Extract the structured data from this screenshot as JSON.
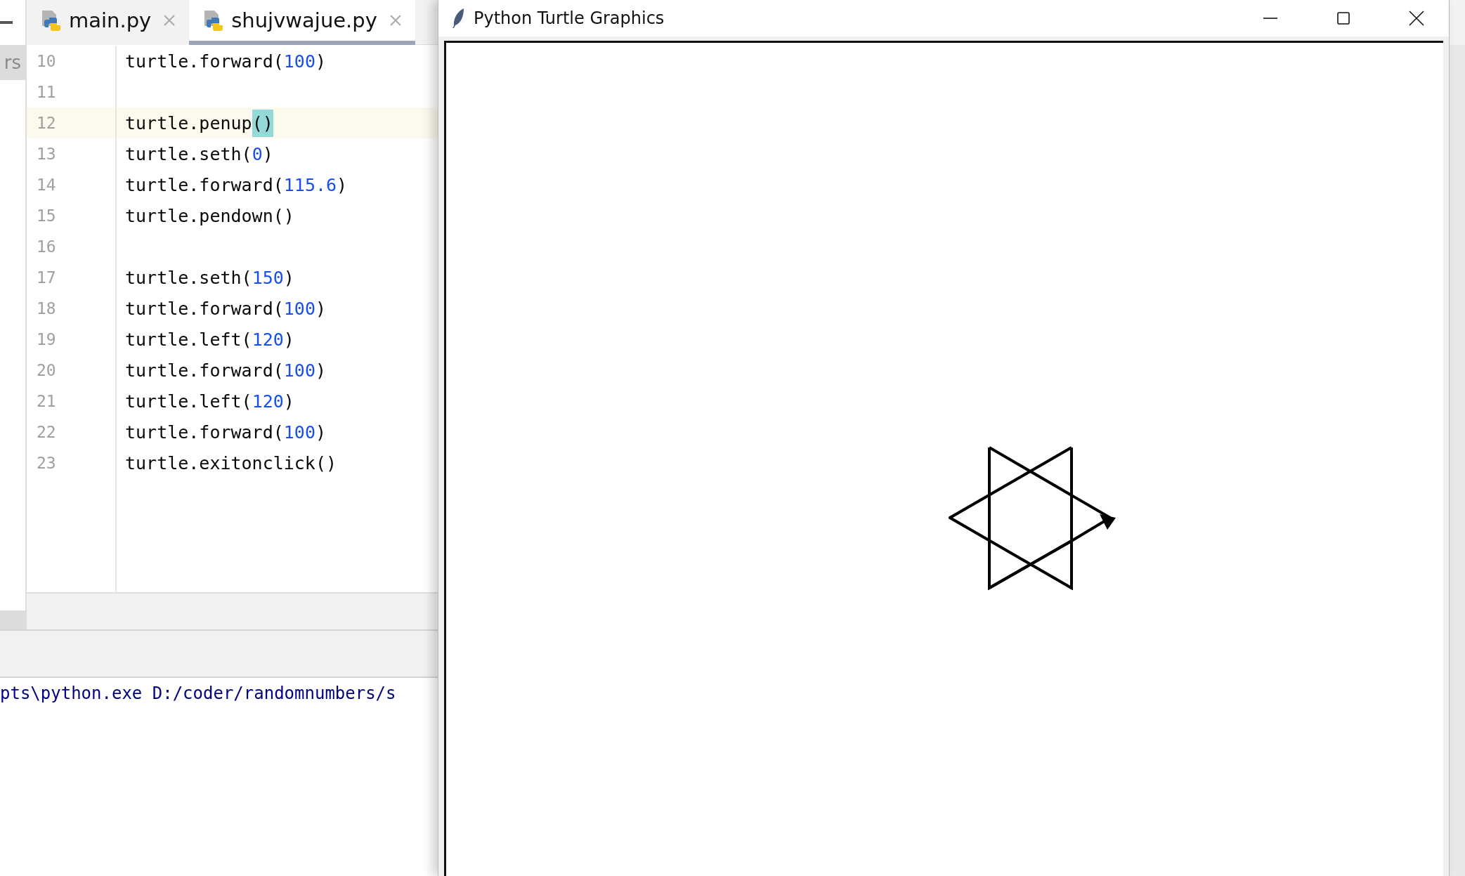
{
  "ide": {
    "sidebar_label": "rs",
    "tabs": [
      {
        "label": "main.py",
        "selected": false
      },
      {
        "label": "shujvwajue.py",
        "selected": true
      }
    ],
    "lines": [
      {
        "number": "10",
        "current": false,
        "tokens": [
          {
            "text": "turtle.forward(",
            "kind": "plain"
          },
          {
            "text": "100",
            "kind": "number"
          },
          {
            "text": ")",
            "kind": "plain"
          }
        ]
      },
      {
        "number": "11",
        "current": false
      },
      {
        "number": "12",
        "current": true,
        "tokens": [
          {
            "text": "turtle.penup",
            "kind": "plain"
          },
          {
            "text": "()",
            "kind": "match"
          }
        ]
      },
      {
        "number": "13",
        "current": false,
        "tokens": [
          {
            "text": "turtle.seth(",
            "kind": "plain"
          },
          {
            "text": "0",
            "kind": "number"
          },
          {
            "text": ")",
            "kind": "plain"
          }
        ]
      },
      {
        "number": "14",
        "current": false,
        "tokens": [
          {
            "text": "turtle.forward(",
            "kind": "plain"
          },
          {
            "text": "115.6",
            "kind": "number"
          },
          {
            "text": ")",
            "kind": "plain"
          }
        ]
      },
      {
        "number": "15",
        "current": false,
        "tokens": [
          {
            "text": "turtle.pendown()",
            "kind": "plain"
          }
        ]
      },
      {
        "number": "16",
        "current": false
      },
      {
        "number": "17",
        "current": false,
        "tokens": [
          {
            "text": "turtle.seth(",
            "kind": "plain"
          },
          {
            "text": "150",
            "kind": "number"
          },
          {
            "text": ")",
            "kind": "plain"
          }
        ]
      },
      {
        "number": "18",
        "current": false,
        "tokens": [
          {
            "text": "turtle.forward(",
            "kind": "plain"
          },
          {
            "text": "100",
            "kind": "number"
          },
          {
            "text": ")",
            "kind": "plain"
          }
        ]
      },
      {
        "number": "19",
        "current": false,
        "tokens": [
          {
            "text": "turtle.left(",
            "kind": "plain"
          },
          {
            "text": "120",
            "kind": "number"
          },
          {
            "text": ")",
            "kind": "plain"
          }
        ]
      },
      {
        "number": "20",
        "current": false,
        "tokens": [
          {
            "text": "turtle.forward(",
            "kind": "plain"
          },
          {
            "text": "100",
            "kind": "number"
          },
          {
            "text": ")",
            "kind": "plain"
          }
        ]
      },
      {
        "number": "21",
        "current": false,
        "tokens": [
          {
            "text": "turtle.left(",
            "kind": "plain"
          },
          {
            "text": "120",
            "kind": "number"
          },
          {
            "text": ")",
            "kind": "plain"
          }
        ]
      },
      {
        "number": "22",
        "current": false,
        "tokens": [
          {
            "text": "turtle.forward(",
            "kind": "plain"
          },
          {
            "text": "100",
            "kind": "number"
          },
          {
            "text": ")",
            "kind": "plain"
          }
        ]
      },
      {
        "number": "23",
        "current": false,
        "tokens": [
          {
            "text": "turtle.exitonclick()",
            "kind": "plain"
          }
        ]
      }
    ],
    "console_line": "pts\\python.exe D:/coder/randomnumbers/s"
  },
  "turtle_window": {
    "title": "Python Turtle Graphics"
  }
}
